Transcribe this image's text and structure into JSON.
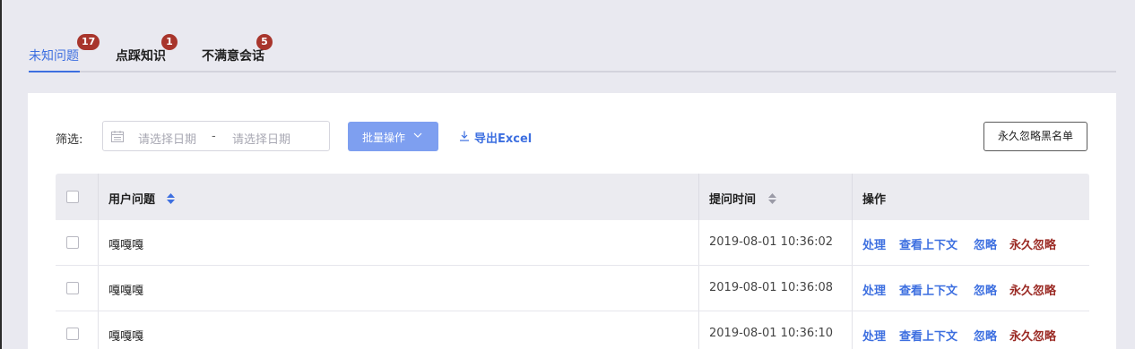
{
  "tabs": [
    {
      "label": "未知问题",
      "badge": "17",
      "active": true
    },
    {
      "label": "点踩知识",
      "badge": "1",
      "active": false
    },
    {
      "label": "不满意会话",
      "badge": "5",
      "active": false
    }
  ],
  "filter": {
    "label": "筛选:",
    "start_placeholder": "请选择日期",
    "separator": "-",
    "end_placeholder": "请选择日期"
  },
  "toolbar": {
    "batch_label": "批量操作",
    "export_label": "导出Excel",
    "blacklist_label": "永久忽略黑名单"
  },
  "table": {
    "columns": [
      "用户问题",
      "提问时间",
      "操作"
    ],
    "rows": [
      {
        "question": "嘎嘎嘎",
        "time": "2019-08-01 10:36:02"
      },
      {
        "question": "嘎嘎嘎",
        "time": "2019-08-01 10:36:08"
      },
      {
        "question": "嘎嘎嘎",
        "time": "2019-08-01 10:36:10"
      }
    ],
    "actions": [
      "处理",
      "查看上下文",
      "忽略",
      "永久忽略"
    ]
  },
  "colors": {
    "accent": "#3d6fe0",
    "danger": "#9b2b25",
    "badge": "#a8352c"
  }
}
